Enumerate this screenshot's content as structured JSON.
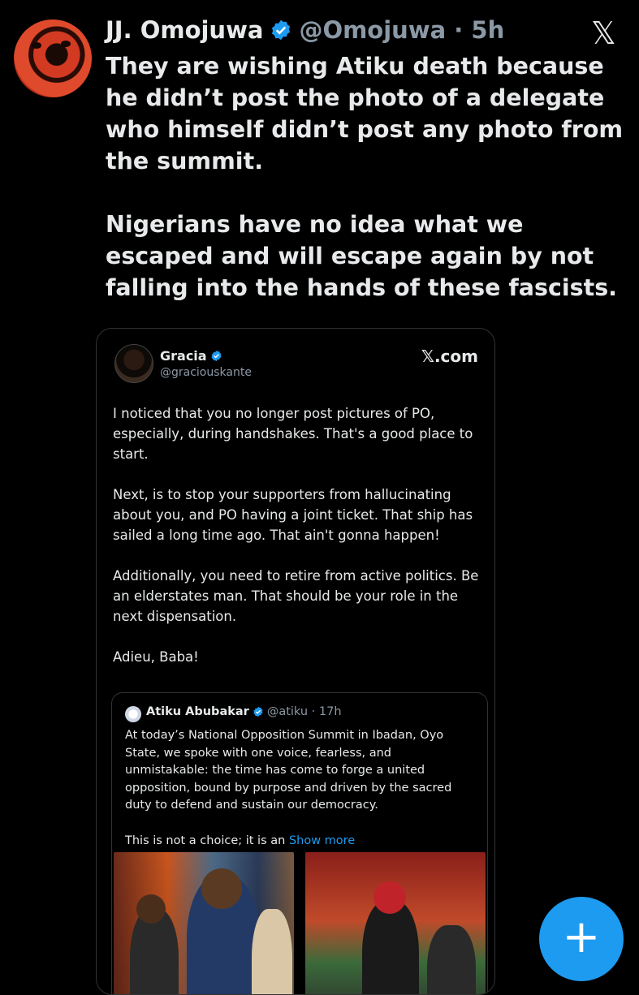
{
  "post": {
    "author_name": "JJ. Omojuwa",
    "handle_time": "@Omojuwa · 5h",
    "paragraphs": [
      "They are wishing Atiku death because he didn’t post the photo of a delegate who himself didn’t post any photo from the summit.",
      "Nigerians have no idea what we escaped and will escape again by not falling into the hands of these fascists."
    ]
  },
  "x_logo": "𝕏",
  "quote": {
    "author_name": "Gracia",
    "handle": "@graciouskante",
    "source": "𝕏.com",
    "paragraphs": [
      "I noticed that you no longer post pictures of PO, especially, during handshakes. That's a good place to start.",
      " Next, is to stop your supporters from hallucinating about you, and PO having a joint ticket. That ship has sailed a long time ago. That ain't gonna happen!",
      "Additionally,  you need to retire from active politics. Be an elderstates man. That should be your role in the next dispensation.",
      "Adieu, Baba!"
    ]
  },
  "inner_quote": {
    "author_name": "Atiku Abubakar",
    "handle_time": "@atiku · 17h",
    "paragraph": "At today’s National Opposition Summit in Ibadan, Oyo State, we spoke with one voice, fearless, and unmistakable: the time has come to forge a united opposition, bound by purpose and driven by the sacred duty to defend and sustain our democracy.",
    "truncated": "This is not a choice; it is an ",
    "show_more": "Show more"
  },
  "fab_label": "+",
  "colors": {
    "accent": "#1d9bf0",
    "background": "#000000",
    "text": "#e7e9ea",
    "muted": "#8b98a5"
  }
}
